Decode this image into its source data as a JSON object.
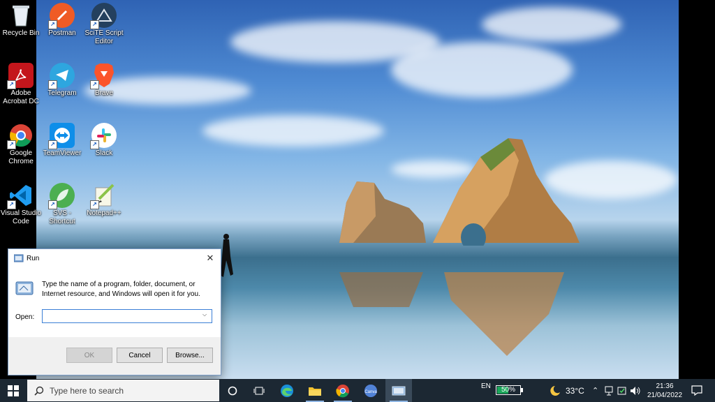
{
  "desktop": {
    "icons": [
      {
        "label": "Recycle Bin",
        "icon": "recycle-bin-icon"
      },
      {
        "label": "Postman",
        "icon": "postman-icon"
      },
      {
        "label": "SciTE Script Editor",
        "icon": "scite-icon"
      },
      {
        "label": "Adobe Acrobat DC",
        "icon": "acrobat-icon"
      },
      {
        "label": "Telegram",
        "icon": "telegram-icon"
      },
      {
        "label": "Brave",
        "icon": "brave-icon"
      },
      {
        "label": "Google Chrome",
        "icon": "chrome-icon"
      },
      {
        "label": "TeamViewer",
        "icon": "teamviewer-icon"
      },
      {
        "label": "Slack",
        "icon": "slack-icon"
      },
      {
        "label": "Visual Studio Code",
        "icon": "vscode-icon"
      },
      {
        "label": "SVS - Shortcut",
        "icon": "svs-icon"
      },
      {
        "label": "Notepad++",
        "icon": "notepadpp-icon"
      }
    ]
  },
  "run_dialog": {
    "title": "Run",
    "description": "Type the name of a program, folder, document, or Internet resource, and Windows will open it for you.",
    "open_label": "Open:",
    "open_value": "",
    "ok_label": "OK",
    "cancel_label": "Cancel",
    "browse_label": "Browse..."
  },
  "taskbar": {
    "search_placeholder": "Type here to search",
    "apps": [
      "Task View",
      "Microsoft Edge",
      "File Explorer",
      "Google Chrome",
      "Canva",
      "Run"
    ],
    "language": "EN",
    "battery_percent": "50%",
    "battery_level": 0.5,
    "weather": "33°C",
    "time": "21:36",
    "date": "21/04/2022"
  },
  "colors": {
    "taskbar_bg": "#1c2833",
    "accent": "#3b7fd6",
    "battery": "#1aa75a"
  }
}
